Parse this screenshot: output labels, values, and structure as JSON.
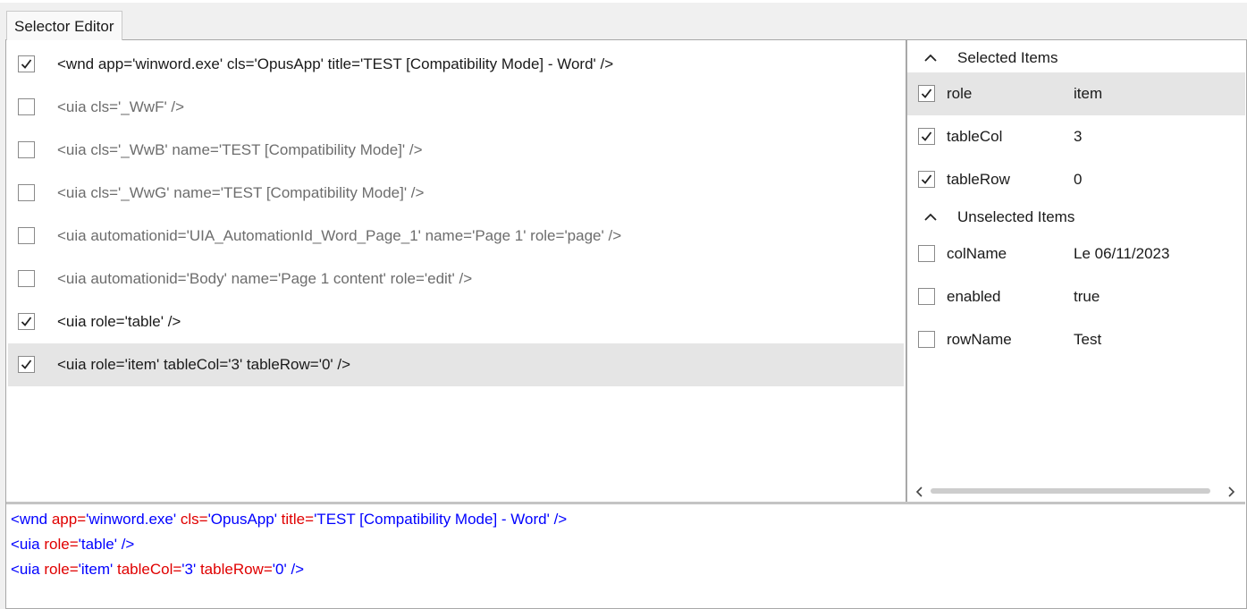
{
  "window": {
    "tab_title": "Selector Editor"
  },
  "nodes": [
    {
      "text": "<wnd app='winword.exe' cls='OpusApp' title='TEST [Compatibility Mode] - Word' />",
      "checked": true,
      "selected": false
    },
    {
      "text": "<uia cls='_WwF' />",
      "checked": false,
      "selected": false
    },
    {
      "text": "<uia cls='_WwB' name='TEST [Compatibility Mode]' />",
      "checked": false,
      "selected": false
    },
    {
      "text": "<uia cls='_WwG' name='TEST [Compatibility Mode]' />",
      "checked": false,
      "selected": false
    },
    {
      "text": "<uia automationid='UIA_AutomationId_Word_Page_1' name='Page 1' role='page' />",
      "checked": false,
      "selected": false
    },
    {
      "text": "<uia automationid='Body' name='Page 1 content' role='edit' />",
      "checked": false,
      "selected": false
    },
    {
      "text": "<uia role='table' />",
      "checked": true,
      "selected": false
    },
    {
      "text": "<uia role='item' tableCol='3' tableRow='0' />",
      "checked": true,
      "selected": true
    }
  ],
  "attributes": {
    "selected_header": "Selected Items",
    "unselected_header": "Unselected Items",
    "selected": [
      {
        "name": "role",
        "value": "item",
        "checked": true,
        "highlighted": true
      },
      {
        "name": "tableCol",
        "value": "3",
        "checked": true,
        "highlighted": false
      },
      {
        "name": "tableRow",
        "value": "0",
        "checked": true,
        "highlighted": false
      }
    ],
    "unselected": [
      {
        "name": "colName",
        "value": "Le 06/11/2023",
        "checked": false
      },
      {
        "name": "enabled",
        "value": "true",
        "checked": false
      },
      {
        "name": "rowName",
        "value": "Test",
        "checked": false
      }
    ]
  },
  "selector_preview": {
    "lines": [
      [
        {
          "t": "<wnd ",
          "c": "tk"
        },
        {
          "t": "app=",
          "c": "ak"
        },
        {
          "t": "'winword.exe' ",
          "c": "av"
        },
        {
          "t": "cls=",
          "c": "ak"
        },
        {
          "t": "'OpusApp' ",
          "c": "av"
        },
        {
          "t": "title=",
          "c": "ak"
        },
        {
          "t": "'TEST [Compatibility Mode] - Word' ",
          "c": "av"
        },
        {
          "t": "/>",
          "c": "tk"
        }
      ],
      [
        {
          "t": "<uia ",
          "c": "tk"
        },
        {
          "t": "role=",
          "c": "ak"
        },
        {
          "t": "'table' ",
          "c": "av"
        },
        {
          "t": "/>",
          "c": "tk"
        }
      ],
      [
        {
          "t": "<uia ",
          "c": "tk"
        },
        {
          "t": "role=",
          "c": "ak"
        },
        {
          "t": "'item' ",
          "c": "av"
        },
        {
          "t": "tableCol=",
          "c": "ak"
        },
        {
          "t": "'3' ",
          "c": "av"
        },
        {
          "t": "tableRow=",
          "c": "ak"
        },
        {
          "t": "'0' ",
          "c": "av"
        },
        {
          "t": "/>",
          "c": "tk"
        }
      ]
    ]
  },
  "colors": {
    "tag": "#0000ff",
    "attribute_name": "#e00000",
    "attribute_value": "#0000ff",
    "selected_row": "#e5e5e5"
  }
}
